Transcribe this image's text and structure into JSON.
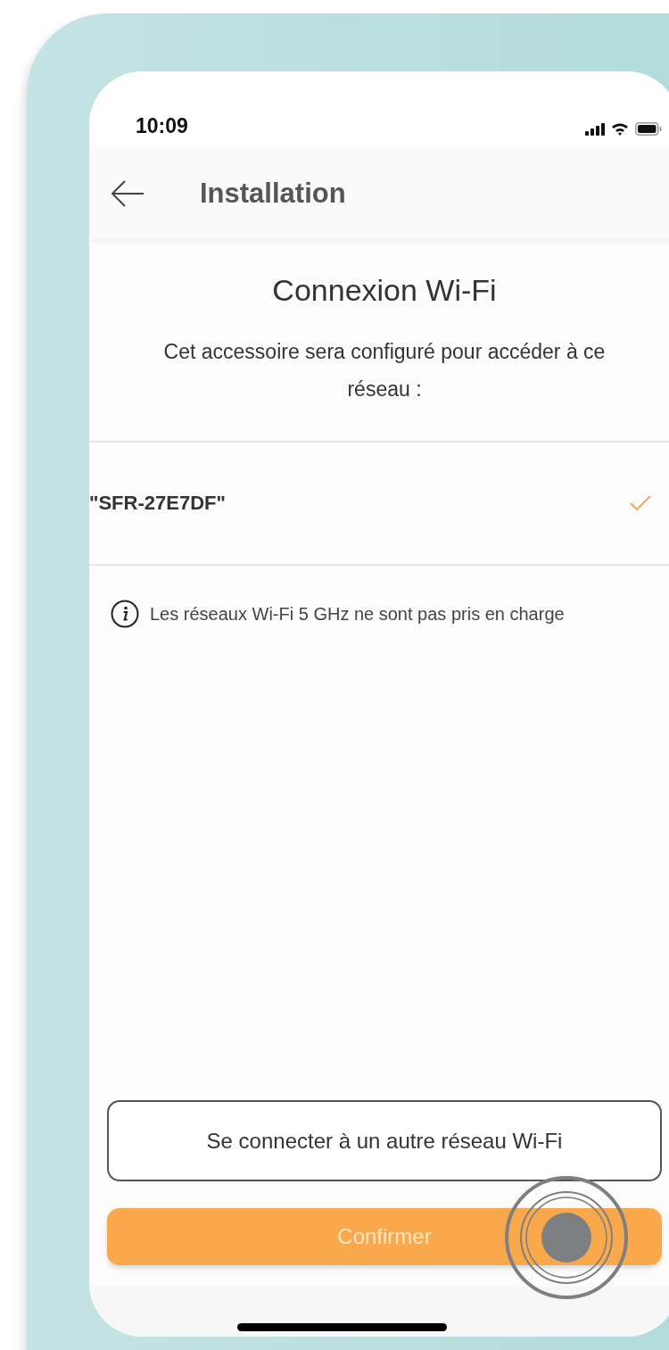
{
  "status_bar": {
    "time": "10:09"
  },
  "header": {
    "title": "Installation"
  },
  "heading": "Connexion Wi-Fi",
  "description": "Cet accessoire sera configuré pour accéder à ce réseau :",
  "networks": [
    {
      "name": "\"SFR-27E7DF\"",
      "selected": true
    }
  ],
  "info": "Les réseaux Wi-Fi 5 GHz ne sont pas pris en charge",
  "buttons": [
    {
      "kind": "outline",
      "label": "Se connecter à un autre réseau Wi-Fi"
    },
    {
      "kind": "primary",
      "label": "Confirmer"
    }
  ]
}
